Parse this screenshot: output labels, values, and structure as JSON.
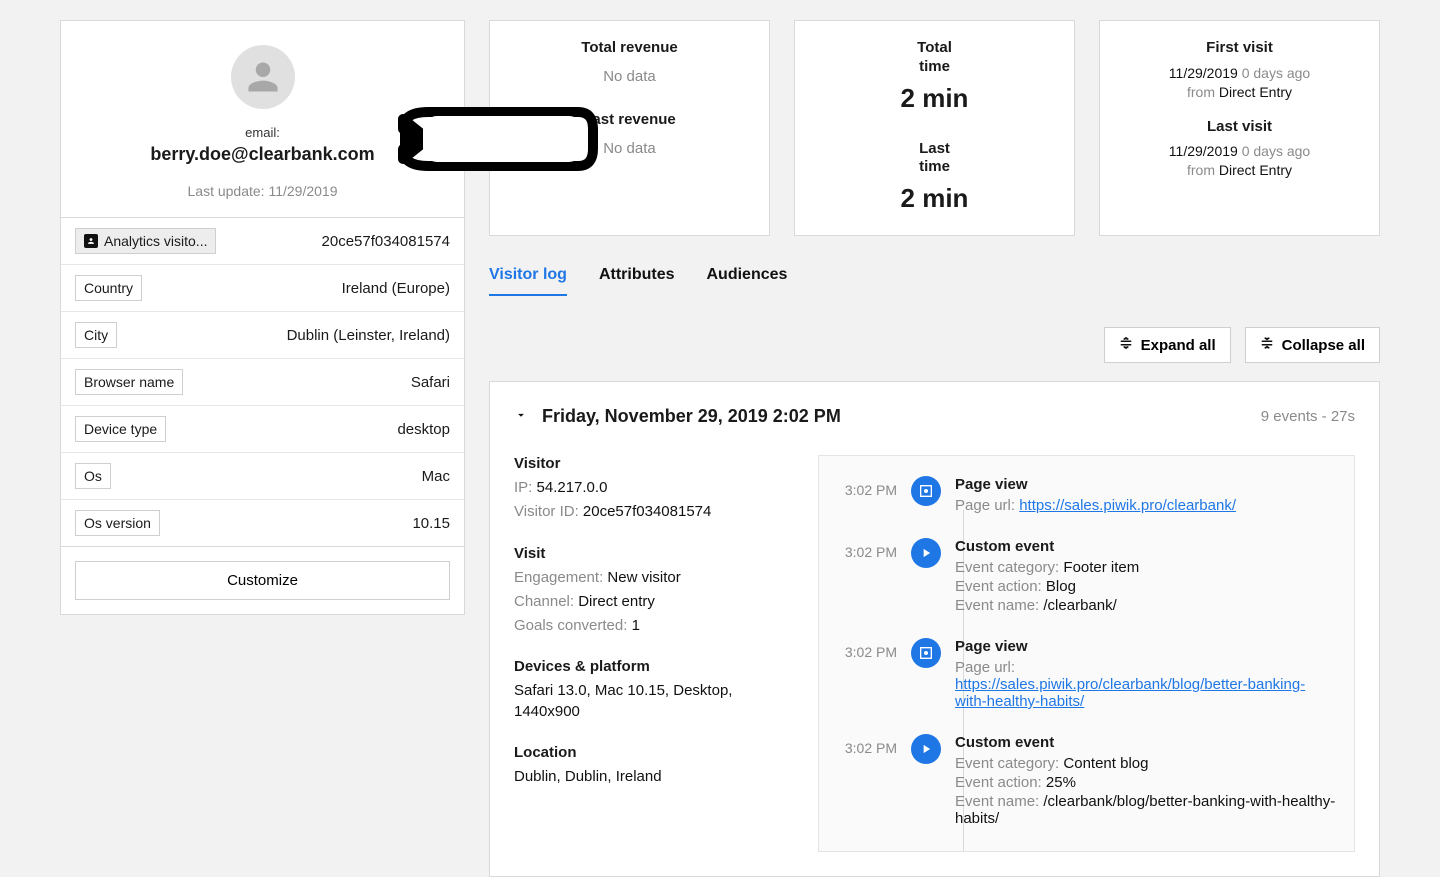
{
  "profile": {
    "email_label": "email:",
    "email_value": "berry.doe@clearbank.com",
    "last_update_label": "Last update: 11/29/2019"
  },
  "attributes": [
    {
      "key": "Analytics visito...",
      "value": "20ce57f034081574",
      "highlight": true,
      "has_icon": true
    },
    {
      "key": "Country",
      "value": "Ireland (Europe)"
    },
    {
      "key": "City",
      "value": "Dublin (Leinster, Ireland)"
    },
    {
      "key": "Browser name",
      "value": "Safari"
    },
    {
      "key": "Device type",
      "value": "desktop"
    },
    {
      "key": "Os",
      "value": "Mac"
    },
    {
      "key": "Os version",
      "value": "10.15"
    }
  ],
  "customize_label": "Customize",
  "stats": {
    "card1": {
      "t1": "Total revenue",
      "v1": "No data",
      "t2": "Last revenue",
      "v2": "No data"
    },
    "card2": {
      "t1": "Total time",
      "v1": "2 min",
      "t2": "Last time",
      "v2": "2 min"
    },
    "card3": {
      "t1": "First visit",
      "date1": "11/29/2019",
      "ago1": "0 days ago",
      "from_lbl1": "from ",
      "from1": "Direct Entry",
      "t2": "Last visit",
      "date2": "11/29/2019",
      "ago2": "0 days ago",
      "from_lbl2": "from ",
      "from2": "Direct Entry"
    }
  },
  "tabs": {
    "t0": "Visitor log",
    "t1": "Attributes",
    "t2": "Audiences"
  },
  "controls": {
    "expand": "Expand all",
    "collapse": "Collapse all"
  },
  "session": {
    "date": "Friday, November 29, 2019 2:02 PM",
    "meta": "9 events - 27s",
    "visitor_h": "Visitor",
    "ip_k": "IP: ",
    "ip_v": "54.217.0.0",
    "vid_k": "Visitor ID: ",
    "vid_v": "20ce57f034081574",
    "visit_h": "Visit",
    "eng_k": "Engagement: ",
    "eng_v": "New visitor",
    "chan_k": "Channel: ",
    "chan_v": "Direct entry",
    "goals_k": "Goals converted: ",
    "goals_v": "1",
    "dev_h": "Devices & platform",
    "dev_v": "Safari 13.0, Mac 10.15, Desktop, 1440x900",
    "loc_h": "Location",
    "loc_v": "Dublin, Dublin, Ireland"
  },
  "events": {
    "e0": {
      "time": "3:02 PM",
      "type": "page",
      "title": "Page view",
      "l0k": "Page url: ",
      "l0link": "https://sales.piwik.pro/clearbank/"
    },
    "e1": {
      "time": "3:02 PM",
      "type": "custom",
      "title": "Custom event",
      "l0k": "Event category: ",
      "l0v": "Footer item",
      "l1k": "Event action: ",
      "l1v": "Blog",
      "l2k": "Event name: ",
      "l2v": "/clearbank/"
    },
    "e2": {
      "time": "3:02 PM",
      "type": "page",
      "title": "Page view",
      "l0k": "Page url: ",
      "l0link": "https://sales.piwik.pro/clearbank/blog/better-banking-with-healthy-habits/"
    },
    "e3": {
      "time": "3:02 PM",
      "type": "custom",
      "title": "Custom event",
      "l0k": "Event category: ",
      "l0v": "Content blog",
      "l1k": "Event action: ",
      "l1v": "25%",
      "l2k": "Event name: ",
      "l2v": "/clearbank/blog/better-banking-with-healthy-habits/"
    }
  }
}
